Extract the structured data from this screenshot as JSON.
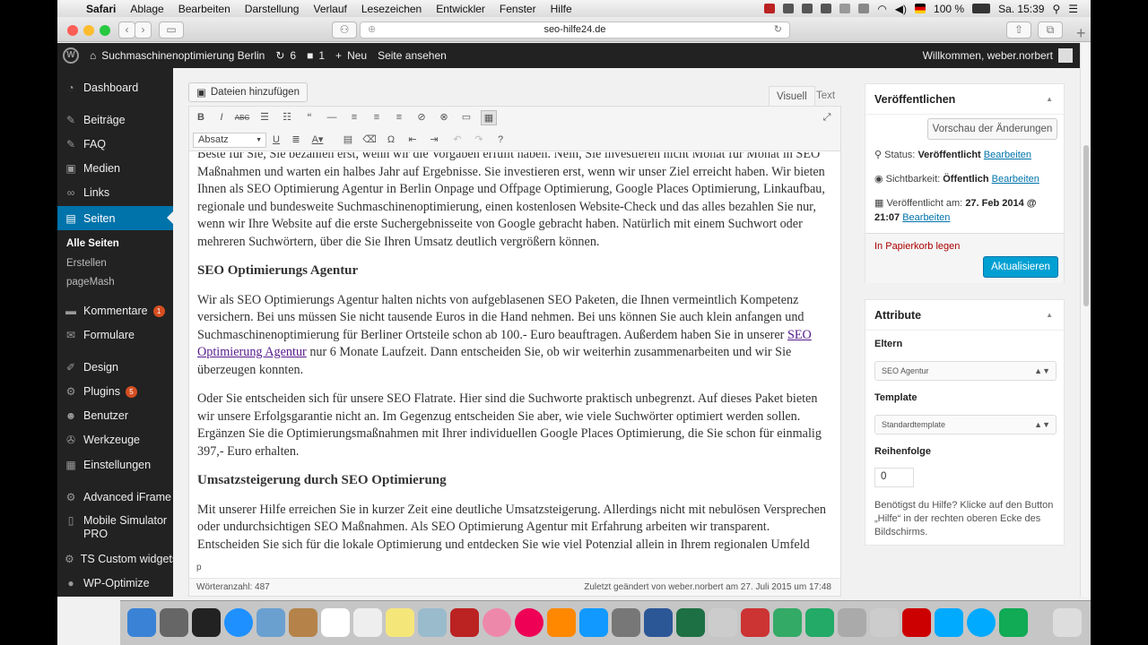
{
  "menubar": {
    "app": "Safari",
    "items": [
      "Ablage",
      "Bearbeiten",
      "Darstellung",
      "Verlauf",
      "Lesezeichen",
      "Entwickler",
      "Fenster",
      "Hilfe"
    ],
    "battery": "100 %",
    "clock": "Sa. 15:39"
  },
  "browser": {
    "url": "seo-hilfe24.de"
  },
  "adminbar": {
    "site": "Suchmaschinenoptimierung Berlin",
    "updates": "6",
    "comments": "1",
    "new_label": "Neu",
    "view_label": "Seite ansehen",
    "welcome": "Willkommen, weber.norbert"
  },
  "sidebar": {
    "items": [
      {
        "label": "Dashboard"
      },
      {
        "label": "Beiträge"
      },
      {
        "label": "FAQ"
      },
      {
        "label": "Medien"
      },
      {
        "label": "Links"
      },
      {
        "label": "Seiten"
      },
      {
        "label": "Kommentare",
        "badge": "1"
      },
      {
        "label": "Formulare"
      },
      {
        "label": "Design"
      },
      {
        "label": "Plugins",
        "badge": "5"
      },
      {
        "label": "Benutzer"
      },
      {
        "label": "Werkzeuge"
      },
      {
        "label": "Einstellungen"
      },
      {
        "label": "Advanced iFrame"
      },
      {
        "label": "Mobile Simulator PRO"
      },
      {
        "label": "TS Custom widgets"
      },
      {
        "label": "WP-Optimize"
      }
    ],
    "subitems": [
      "Alle Seiten",
      "Erstellen",
      "pageMash"
    ]
  },
  "editor": {
    "media_button": "Dateien hinzufügen",
    "tab_visual": "Visuell",
    "tab_text": "Text",
    "format_select": "Absatz",
    "paragraphs": [
      "Beste für Sie, Sie bezahlen erst, wenn wir die Vorgaben erfüllt haben. Nein, Sie investieren nicht Monat für Monat in SEO Maßnahmen und warten ein halbes Jahr auf Ergebnisse. Sie investieren erst, wenn wir unser Ziel erreicht haben. Wir bieten Ihnen als SEO Optimierung Agentur in Berlin Onpage und Offpage Optimierung, Google Places Optimierung, Linkaufbau, regionale und bundesweite Suchmaschinenoptimierung, einen kostenlosen Website-Check und das alles bezahlen Sie nur, wenn wir Ihre Website auf die erste Suchergebnisseite von Google gebracht haben. Natürlich mit einem Suchwort oder mehreren Suchwörtern, über die Sie Ihren Umsatz deutlich vergrößern können.",
      "Wir als SEO Optimierungs Agentur halten nichts von aufgeblasenen SEO Paketen, die Ihnen vermeintlich Kompetenz versichern. Bei uns müssen Sie nicht tausende Euros in die Hand nehmen. Bei uns können Sie auch klein anfangen und Suchmaschinenoptimierung für Berliner Ortsteile schon ab 100.- Euro beauftragen. Außerdem haben Sie in unserer",
      "nur 6 Monate Laufzeit. Dann entscheiden Sie, ob wir weiterhin zusammenarbeiten und wir Sie überzeugen konnten.",
      "Oder Sie entscheiden sich für unsere SEO Flatrate. Hier sind die Suchworte praktisch unbegrenzt. Auf dieses Paket bieten wir unsere Erfolgsgarantie nicht an. Im Gegenzug entscheiden Sie aber, wie viele Suchwörter optimiert werden sollen. Ergänzen Sie die Optimierungsmaßnahmen mit Ihrer individuellen Google Places Optimierung, die Sie schon für einmalig 397,- Euro erhalten.",
      "Mit unserer Hilfe erreichen Sie in kurzer Zeit eine deutliche Umsatzsteigerung. Allerdings nicht mit nebulösen Versprechen oder undurchsichtigen SEO Maßnahmen. Als SEO Optimierung Agentur mit Erfahrung arbeiten wir transparent. Entscheiden Sie sich für die lokale Optimierung und entdecken Sie wie viel Potenzial allein in Ihrem regionalen Umfeld steckt. Denken Sie um und investieren Sie in die Online-Optimierung statt in Werbeanzeigen lokaler Zeitungen. Sie erreichen online ungleich"
    ],
    "link_text": "SEO Optimierung Agentur",
    "heading1": "SEO Optimierungs Agentur",
    "heading2": "Umsatzsteigerung durch SEO Optimierung",
    "path": "p",
    "word_count": "Wörteranzahl: 487",
    "last_edit": "Zuletzt geändert von weber.norbert am 27. Juli 2015 um 17:48"
  },
  "publish": {
    "title": "Veröffentlichen",
    "preview": "Vorschau der Änderungen",
    "status_label": "Status:",
    "status_value": "Veröffentlicht",
    "visibility_label": "Sichtbarkeit:",
    "visibility_value": "Öffentlich",
    "published_label": "Veröffentlicht am:",
    "published_value": "27. Feb 2014 @",
    "published_time": "21:07",
    "edit": "Bearbeiten",
    "trash": "In Papierkorb legen",
    "update": "Aktualisieren"
  },
  "attributes": {
    "title": "Attribute",
    "parent_label": "Eltern",
    "parent_value": "SEO Agentur",
    "template_label": "Template",
    "template_value": "Standardtemplate",
    "order_label": "Reihenfolge",
    "order_value": "0",
    "help": [
      "Benötigst du Hilfe? Klicke auf den Button",
      "„Hilfe“ in der rechten oberen Ecke des",
      "Bildschirms."
    ]
  },
  "colors": {
    "accent": "#0073aa",
    "adminbar": "#222222",
    "primary_button": "#00a0d2",
    "trash": "#a00000"
  }
}
